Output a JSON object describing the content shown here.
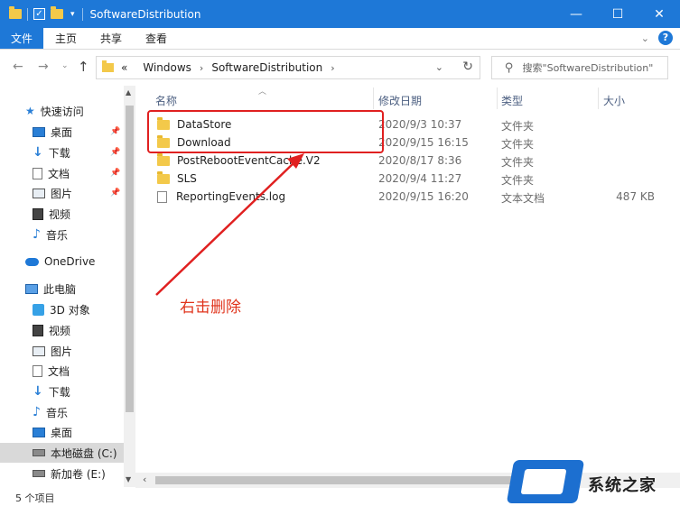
{
  "window": {
    "title": "SoftwareDistribution",
    "controls": [
      "—",
      "☐",
      "✕"
    ]
  },
  "ribbon": {
    "file_tab": "文件",
    "tabs": [
      "主页",
      "共享",
      "查看"
    ]
  },
  "address": {
    "crumbs": [
      "«",
      "Windows",
      "SoftwareDistribution"
    ],
    "search_placeholder": "搜索\"SoftwareDistribution\""
  },
  "nav_pane": {
    "quick_access": "快速访问",
    "quick_items": [
      "桌面",
      "下载",
      "文档",
      "图片",
      "视频",
      "音乐"
    ],
    "onedrive": "OneDrive",
    "this_pc": "此电脑",
    "pc_items": [
      "3D 对象",
      "视频",
      "图片",
      "文档",
      "下载",
      "音乐",
      "桌面"
    ],
    "drives": [
      "本地磁盘 (C:)",
      "新加卷 (E:)"
    ]
  },
  "columns": {
    "name": "名称",
    "date": "修改日期",
    "type": "类型",
    "size": "大小"
  },
  "files": [
    {
      "name": "DataStore",
      "date": "2020/9/3 10:37",
      "type": "文件夹",
      "size": "",
      "icon": "folder"
    },
    {
      "name": "Download",
      "date": "2020/9/15 16:15",
      "type": "文件夹",
      "size": "",
      "icon": "folder"
    },
    {
      "name": "PostRebootEventCache.V2",
      "date": "2020/8/17 8:36",
      "type": "文件夹",
      "size": "",
      "icon": "folder"
    },
    {
      "name": "SLS",
      "date": "2020/9/4 11:27",
      "type": "文件夹",
      "size": "",
      "icon": "folder"
    },
    {
      "name": "ReportingEvents.log",
      "date": "2020/9/15 16:20",
      "type": "文本文档",
      "size": "487 KB",
      "icon": "file"
    }
  ],
  "status": {
    "count": "5 个项目"
  },
  "annotation": {
    "text": "右击删除",
    "color": "#e02020"
  },
  "watermark": {
    "text": "系统之家"
  },
  "colors": {
    "accent": "#1e78d7",
    "folder": "#f3c94a"
  }
}
